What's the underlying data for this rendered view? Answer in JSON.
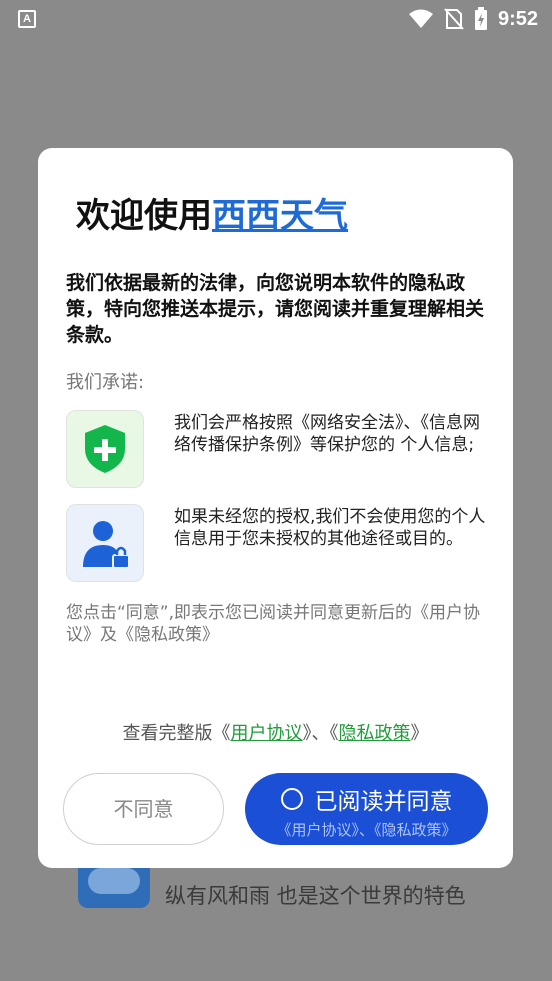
{
  "status_bar": {
    "time": "9:52",
    "left_icon_label": "A"
  },
  "background": {
    "slogan": "纵有风和雨 也是这个世界的特色"
  },
  "dialog": {
    "title_prefix": "欢迎使用",
    "app_name": "西西天气",
    "intro": "我们依据最新的法律，向您说明本软件的隐私政策，特向您推送本提示，请您阅读并重复理解相关条款。",
    "promise_label": "我们承诺:",
    "items": [
      {
        "icon": "shield-plus-icon",
        "text": "我们会严格按照《网络安全法》、《信息网络传播保护条例》等保护您的 个人信息;"
      },
      {
        "icon": "user-lock-icon",
        "text": "如果未经您的授权,我们不会使用您的个人信息用于您未授权的其他途径或目的。"
      }
    ],
    "notice": "您点击“同意”,即表示您已阅读并同意更新后的《用户协议》及《隐私政策》",
    "footer": {
      "prefix": "查看完整版《",
      "user_agreement": "用户协议",
      "middle": "》、《",
      "privacy_policy": "隐私政策",
      "suffix": "》"
    },
    "disagree_label": "不同意",
    "agree_label": "已阅读并同意",
    "agree_sublabel": "《用户协议》、《隐私政策》"
  },
  "colors": {
    "accent": "#1a4fd6",
    "link_blue": "#1e6bd6",
    "link_green": "#1f9d3a"
  }
}
